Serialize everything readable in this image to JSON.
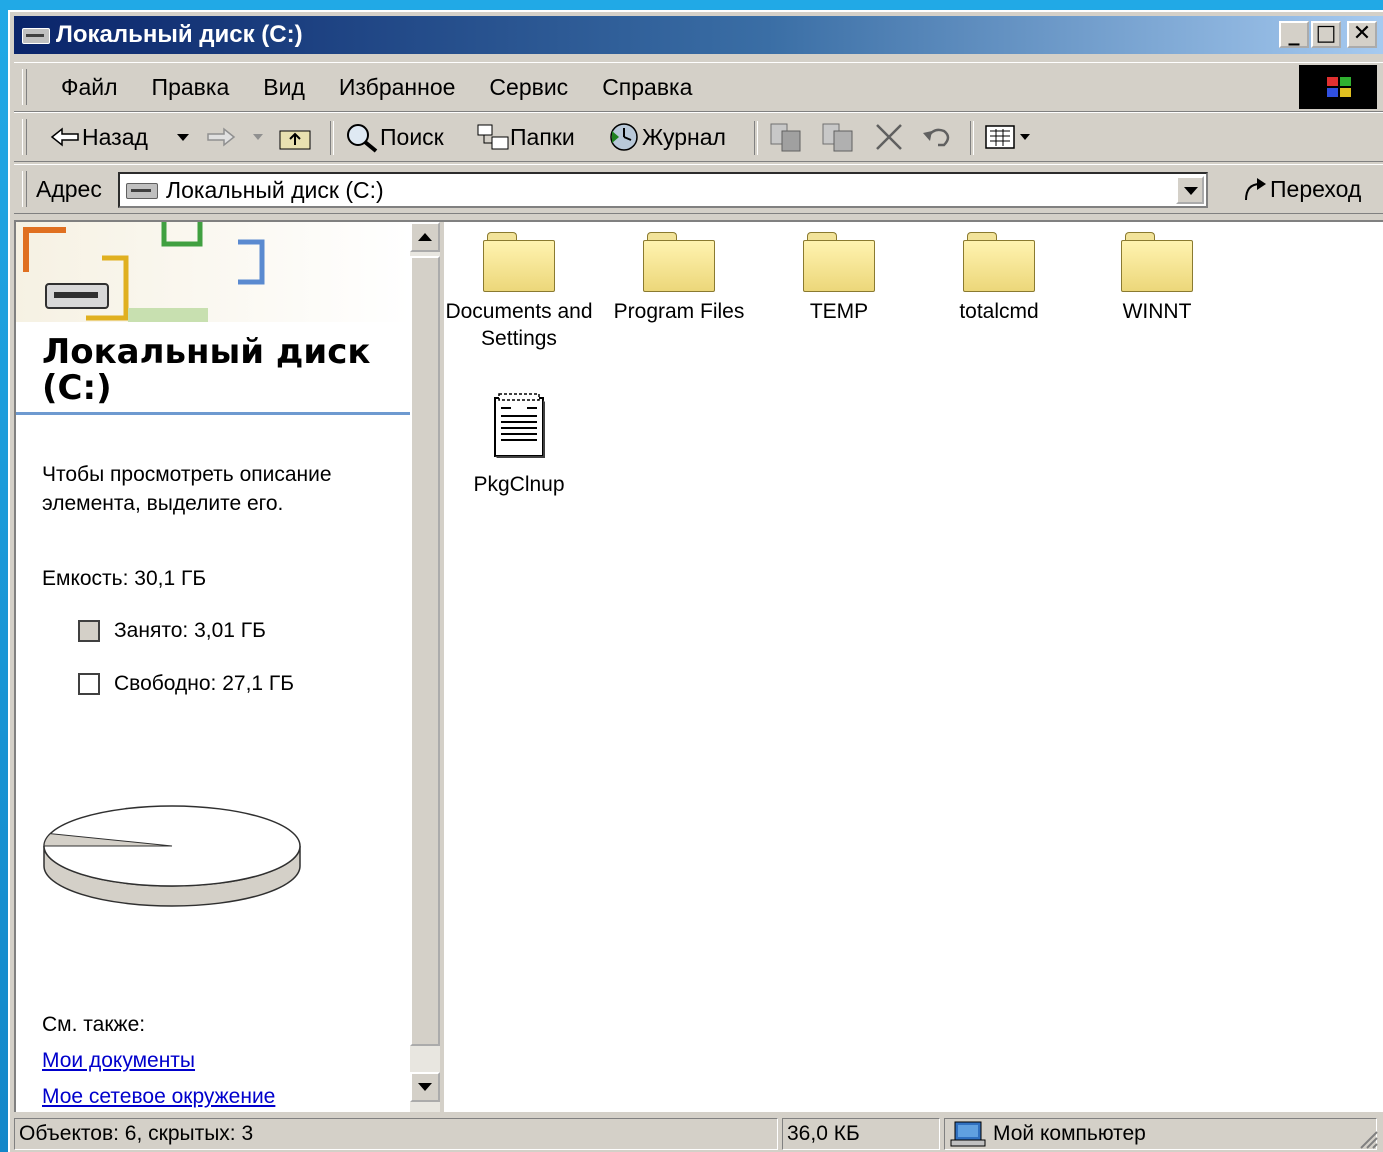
{
  "window": {
    "title": "Локальный диск (C:)"
  },
  "menu": [
    "Файл",
    "Правка",
    "Вид",
    "Избранное",
    "Сервис",
    "Справка"
  ],
  "toolbar": {
    "back": "Назад",
    "search": "Поиск",
    "folders": "Папки",
    "history": "Журнал"
  },
  "address": {
    "label": "Адрес",
    "value": "Локальный диск (C:)",
    "go": "Переход"
  },
  "left_pane": {
    "title": "Локальный диск (C:)",
    "description": "Чтобы просмотреть описание элемента, выделите его.",
    "capacity": "Емкость: 30,1 ГБ",
    "used": "Занято: 3,01 ГБ",
    "free": "Свободно: 27,1 ГБ",
    "used_fraction": 0.1,
    "see_also": "См. также:",
    "links": [
      "Мои документы",
      "Мое сетевое окружение"
    ]
  },
  "files": [
    {
      "name": "Documents and Settings",
      "type": "folder"
    },
    {
      "name": "Program Files",
      "type": "folder"
    },
    {
      "name": "TEMP",
      "type": "folder"
    },
    {
      "name": "totalcmd",
      "type": "folder"
    },
    {
      "name": "WINNT",
      "type": "folder"
    },
    {
      "name": "PkgClnup",
      "type": "file"
    }
  ],
  "status": {
    "objects": "Объектов: 6, скрытых: 3",
    "size": "36,0 КБ",
    "location": "Мой компьютер"
  },
  "colors": {
    "title_start": "#0a246a",
    "title_end": "#a6caf0",
    "face": "#d4d0c8",
    "link": "#0000cc",
    "accent_rule": "#6e9ad0"
  }
}
